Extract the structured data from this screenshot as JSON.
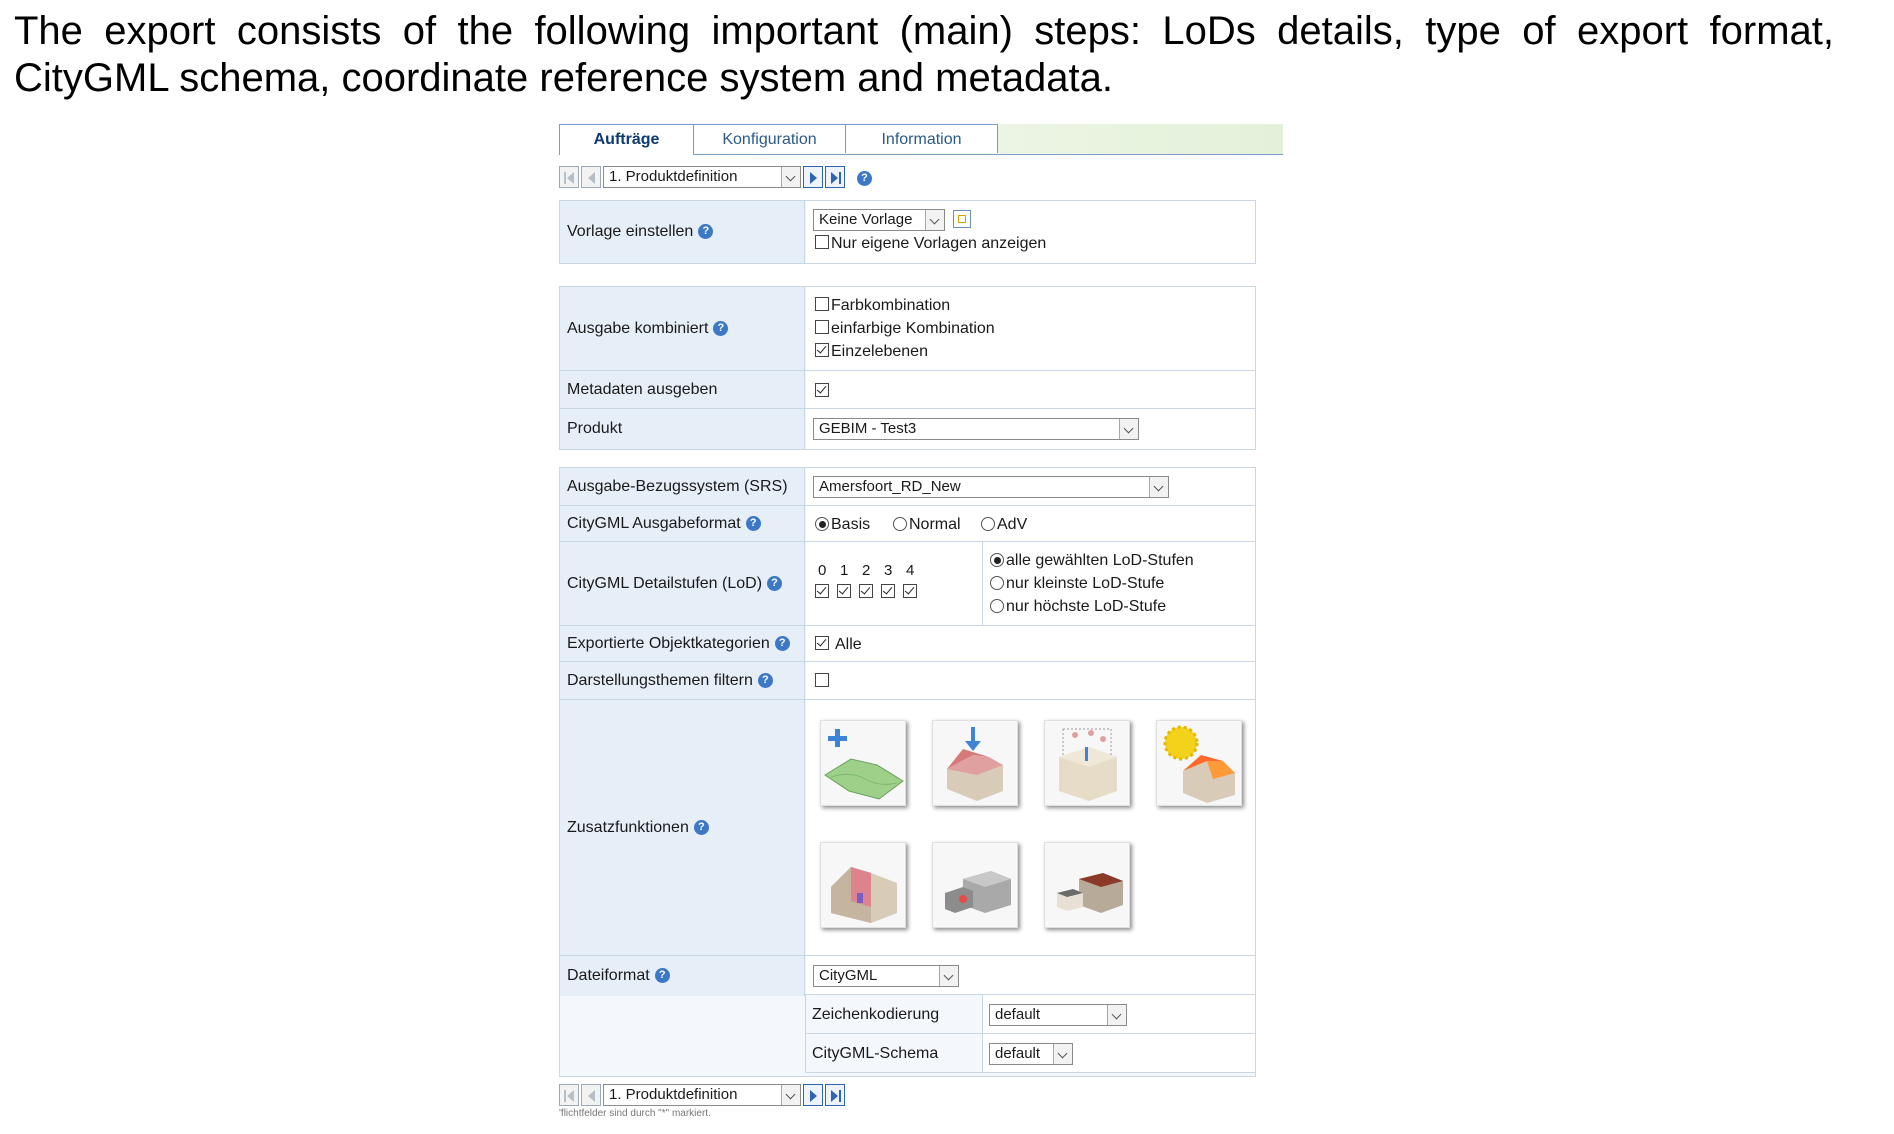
{
  "caption": "The export consists of the following important (main) steps: LoDs details, type of export format, CityGML schema, coordinate reference system and metadata.",
  "tabs": [
    {
      "label": "Aufträge",
      "active": true
    },
    {
      "label": "Konfiguration",
      "active": false
    },
    {
      "label": "Information",
      "active": false
    }
  ],
  "nav": {
    "step_value": "1. Produktdefinition"
  },
  "help_glyph": "?",
  "template": {
    "label": "Vorlage einstellen",
    "select_value": "Keine Vorlage",
    "own_only_label": "Nur eigene Vorlagen anzeigen",
    "own_only_checked": false
  },
  "output_combined": {
    "label": "Ausgabe kombiniert",
    "options": [
      {
        "label": "Farbkombination",
        "checked": false
      },
      {
        "label": "einfarbige Kombination",
        "checked": false
      },
      {
        "label": "Einzelebenen",
        "checked": true
      }
    ]
  },
  "metadata": {
    "label": "Metadaten ausgeben",
    "checked": true
  },
  "product": {
    "label": "Produkt",
    "value": "GEBIM - Test3"
  },
  "srs": {
    "label": "Ausgabe-Bezugssystem (SRS)",
    "value": "Amersfoort_RD_New"
  },
  "citygml_format": {
    "label": "CityGML Ausgabeformat",
    "options": [
      {
        "label": "Basis",
        "selected": true
      },
      {
        "label": "Normal",
        "selected": false
      },
      {
        "label": "AdV",
        "selected": false
      }
    ]
  },
  "lod": {
    "label": "CityGML Detailstufen (LoD)",
    "levels": [
      {
        "num": "0",
        "checked": true
      },
      {
        "num": "1",
        "checked": true
      },
      {
        "num": "2",
        "checked": true
      },
      {
        "num": "3",
        "checked": true
      },
      {
        "num": "4",
        "checked": true
      }
    ],
    "modes": [
      {
        "label": "alle gewählten LoD-Stufen",
        "selected": true
      },
      {
        "label": "nur kleinste LoD-Stufe",
        "selected": false
      },
      {
        "label": "nur höchste LoD-Stufe",
        "selected": false
      }
    ]
  },
  "object_categories": {
    "label": "Exportierte Objektkategorien",
    "value": "Alle",
    "checked": true
  },
  "filter_themes": {
    "label": "Darstellungsthemen filtern",
    "checked": false
  },
  "extras": {
    "label": "Zusatzfunktionen",
    "tiles": [
      "add-terrain-icon",
      "drape-roof-icon",
      "building-extrude-icon",
      "solar-building-icon",
      "facade-texture-icon",
      "building-block-icon",
      "building-simplify-icon"
    ]
  },
  "file_format": {
    "label": "Dateiformat",
    "value": "CityGML"
  },
  "encoding": {
    "label": "Zeichenkodierung",
    "value": "default"
  },
  "schema": {
    "label": "CityGML-Schema",
    "value": "default"
  },
  "footnote": "'flichtfelder sind durch \"*\" markiert."
}
